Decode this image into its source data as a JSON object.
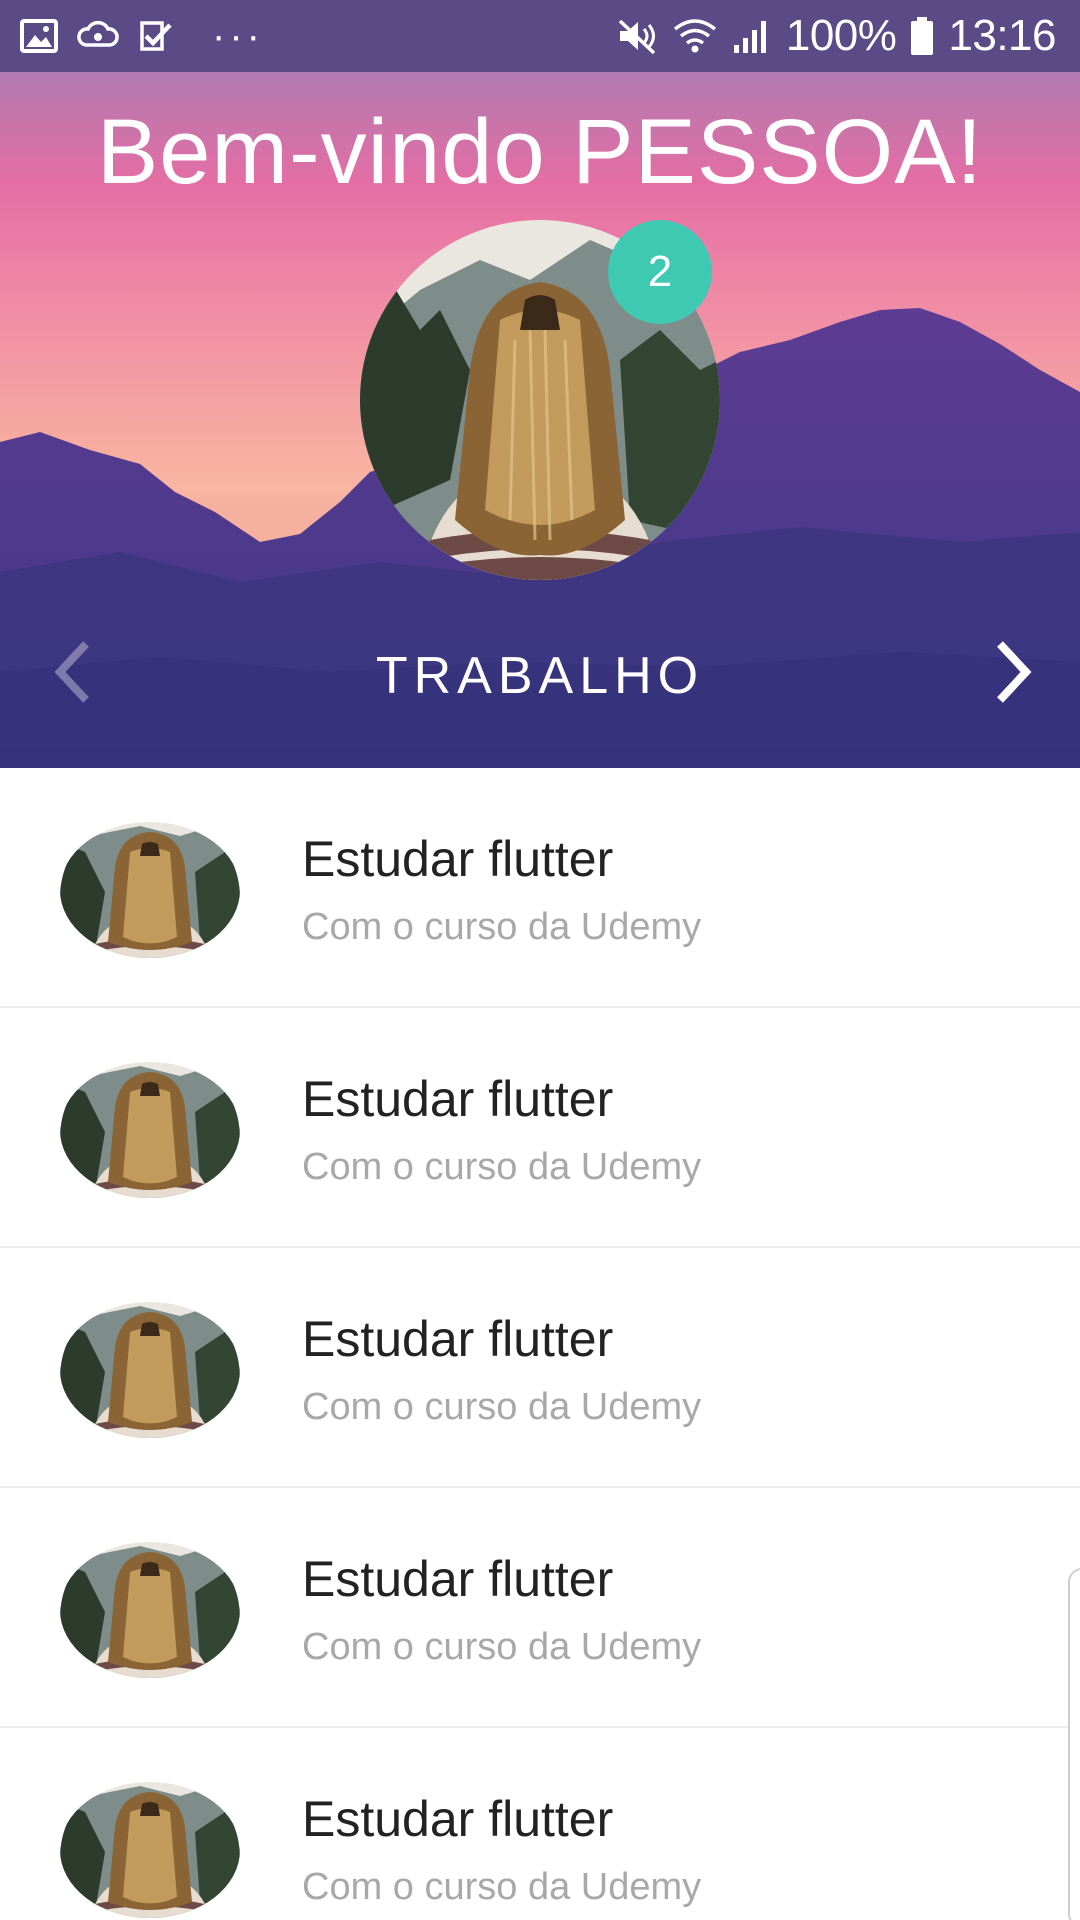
{
  "status_bar": {
    "battery": "100%",
    "time": "13:16",
    "icons": [
      "gallery-icon",
      "cloud-sync-icon",
      "task-check-icon",
      "more-dots-icon",
      "mute-icon",
      "wifi-icon",
      "signal-icon",
      "battery-icon"
    ],
    "more": "···"
  },
  "header": {
    "title": "Bem-vindo PESSOA!",
    "badge_count": "2",
    "category": "TRABALHO",
    "prev_icon": "chevron-left-icon",
    "next_icon": "chevron-right-icon",
    "colors": {
      "badge": "#3fc9b3",
      "mountains": "#4a3a8c",
      "sky_top": "#b17ab0",
      "sky_mid": "#e46ea4",
      "sky_low": "#f9b7a2"
    }
  },
  "tasks": [
    {
      "title": "Estudar flutter",
      "subtitle": "Com o curso da Udemy"
    },
    {
      "title": "Estudar flutter",
      "subtitle": "Com o curso da Udemy"
    },
    {
      "title": "Estudar flutter",
      "subtitle": "Com o curso da Udemy"
    },
    {
      "title": "Estudar flutter",
      "subtitle": "Com o curso da Udemy"
    },
    {
      "title": "Estudar flutter",
      "subtitle": "Com o curso da Udemy"
    }
  ]
}
